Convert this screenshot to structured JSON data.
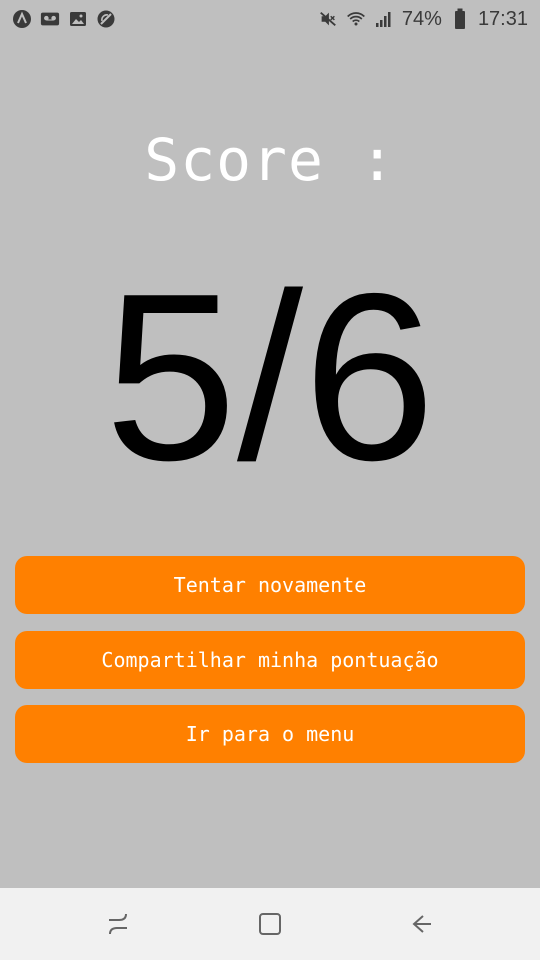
{
  "status_bar": {
    "icons_left": [
      "a-logo-icon",
      "voicemail-icon",
      "gallery-icon",
      "no-sync-icon"
    ],
    "icons_right": [
      "mute-icon",
      "wifi-icon",
      "signal-icon",
      "battery-icon"
    ],
    "battery_percent": "74%",
    "time": "17:31"
  },
  "result": {
    "label": "Score :",
    "value": "5/6"
  },
  "buttons": {
    "retry": "Tentar novamente",
    "share": "Compartilhar minha pontuação",
    "menu": "Ir para o menu"
  },
  "colors": {
    "background": "#bfbfbf",
    "button": "#ff8000",
    "button_text": "#ffffff",
    "score_value": "#000000",
    "nav_bar": "#f1f1f1"
  },
  "nav_bar": {
    "icons": [
      "recents-icon",
      "home-icon",
      "back-icon"
    ]
  }
}
